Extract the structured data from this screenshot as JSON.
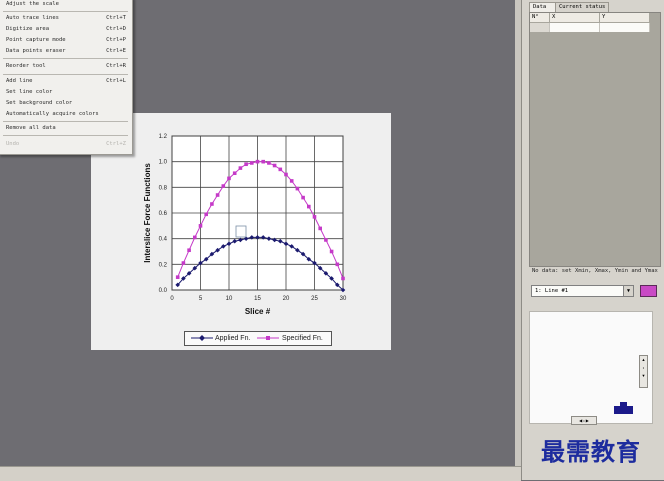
{
  "menu": {
    "items": [
      {
        "label": "Adjust the scale",
        "shortcut": ""
      },
      {
        "label": "Auto trace lines",
        "shortcut": "Ctrl+T"
      },
      {
        "label": "Digitize area",
        "shortcut": "Ctrl+D"
      },
      {
        "label": "Point capture mode",
        "shortcut": "Ctrl+P"
      },
      {
        "label": "Data points eraser",
        "shortcut": "Ctrl+E"
      },
      {
        "label": "Reorder tool",
        "shortcut": "Ctrl+R"
      },
      {
        "label": "Add line",
        "shortcut": "Ctrl+L"
      },
      {
        "label": "Set line color",
        "shortcut": ""
      },
      {
        "label": "Set background color",
        "shortcut": ""
      },
      {
        "label": "Automatically acquire colors",
        "shortcut": ""
      },
      {
        "label": "Remove all data",
        "shortcut": ""
      },
      {
        "label": "Undo",
        "shortcut": "Ctrl+Z"
      }
    ]
  },
  "chart_data": {
    "type": "line",
    "xlabel": "Slice #",
    "ylabel": "Interslice Force Functions",
    "xlim": [
      0,
      30
    ],
    "ylim": [
      0,
      1.2
    ],
    "xticks": [
      "0",
      "5",
      "10",
      "15",
      "20",
      "25",
      "30"
    ],
    "yticks": [
      "0.0",
      "0.2",
      "0.4",
      "0.6",
      "0.8",
      "1.0",
      "1.2"
    ],
    "grid": true,
    "legend": "bottom",
    "x": [
      1,
      2,
      3,
      4,
      5,
      6,
      7,
      8,
      9,
      10,
      11,
      12,
      13,
      14,
      15,
      16,
      17,
      18,
      19,
      20,
      21,
      22,
      23,
      24,
      25,
      26,
      27,
      28,
      29,
      30
    ],
    "series": [
      {
        "name": "Applied Fn.",
        "color": "#1b1a6e",
        "values": [
          0.04,
          0.09,
          0.13,
          0.17,
          0.21,
          0.24,
          0.28,
          0.31,
          0.34,
          0.36,
          0.38,
          0.39,
          0.4,
          0.41,
          0.41,
          0.41,
          0.4,
          0.39,
          0.38,
          0.36,
          0.34,
          0.31,
          0.28,
          0.24,
          0.21,
          0.17,
          0.13,
          0.09,
          0.04,
          0.0
        ]
      },
      {
        "name": "Specified Fn.",
        "color": "#c53ac8",
        "values": [
          0.1,
          0.21,
          0.31,
          0.41,
          0.5,
          0.59,
          0.67,
          0.74,
          0.81,
          0.87,
          0.91,
          0.95,
          0.98,
          0.99,
          1.0,
          1.0,
          0.99,
          0.97,
          0.94,
          0.9,
          0.85,
          0.79,
          0.72,
          0.65,
          0.57,
          0.48,
          0.39,
          0.3,
          0.2,
          0.09
        ]
      }
    ]
  },
  "right_panel": {
    "tabs": [
      "Data",
      "Current status"
    ],
    "columns": [
      "N°",
      "X",
      "Y"
    ],
    "status_text": "No data: set Xmin, Xmax, Ymin and Ymax",
    "line_select_value": "1: Line #1",
    "line_color": "#c94ac5"
  },
  "watermark": "最需教育"
}
